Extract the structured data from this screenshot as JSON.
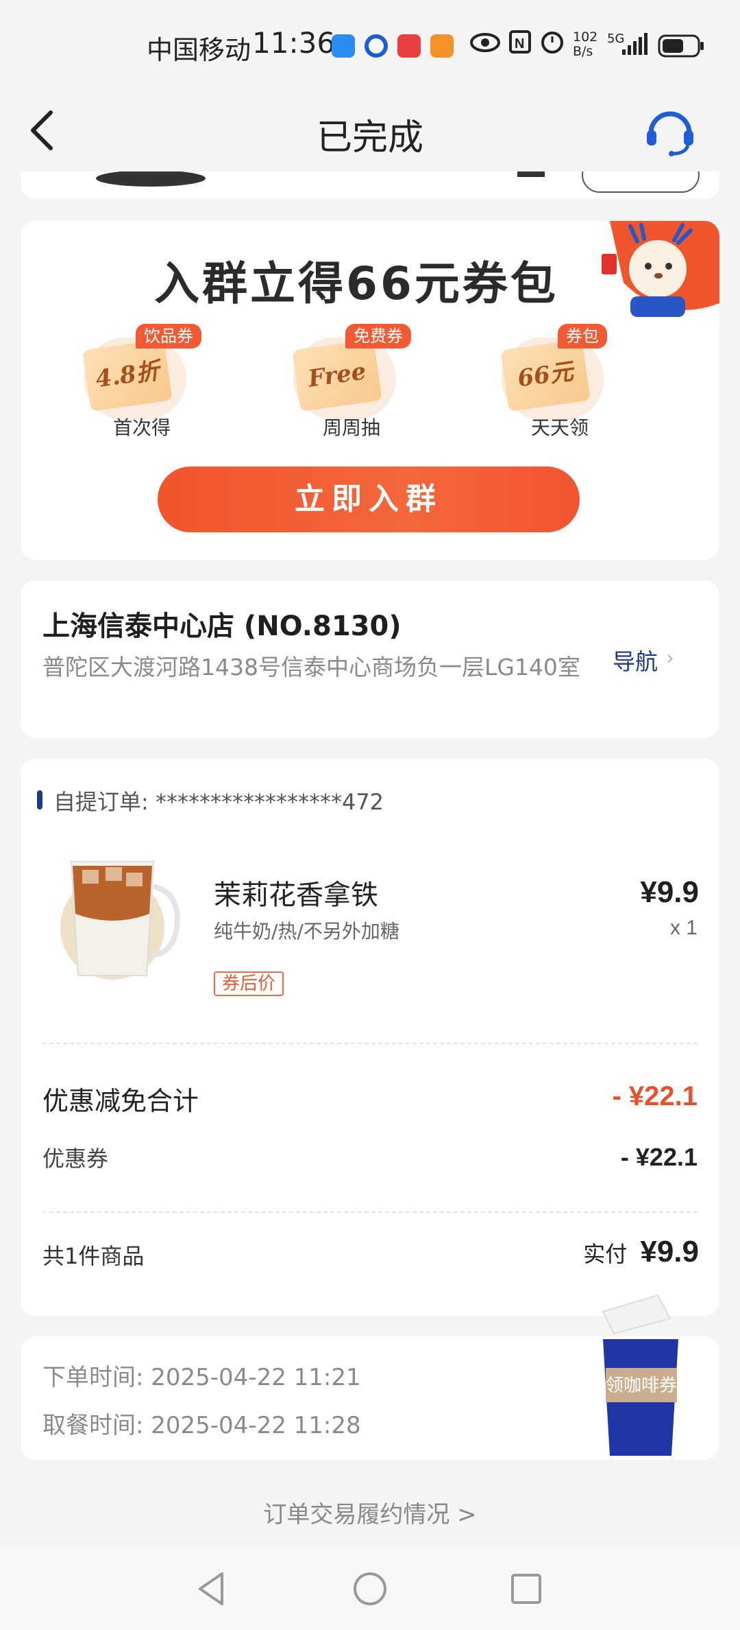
{
  "status_bar": {
    "carrier": "中国移动",
    "time": "11:36",
    "net_speed_top": "102",
    "net_speed_bottom": "B/s",
    "network": "5G"
  },
  "header": {
    "title": "已完成"
  },
  "promo": {
    "title": "入群立得66元券包",
    "benefits": [
      {
        "tag": "饮品券",
        "ticket": "4.8折",
        "label": "首次得"
      },
      {
        "tag": "免费券",
        "ticket": "Free",
        "label": "周周抽"
      },
      {
        "tag": "券包",
        "ticket": "66元",
        "label": "天天领"
      }
    ],
    "button": "立即入群"
  },
  "store": {
    "name": "上海信泰中心店 (NO.8130)",
    "address": "普陀区大渡河路1438号信泰中心商场负一层LG140室",
    "nav_label": "导航"
  },
  "order": {
    "id_label": "自提订单: *****************472",
    "item": {
      "name": "茉莉花香拿铁",
      "spec": "纯牛奶/热/不另外加糖",
      "tag": "券后价",
      "price": "¥9.9",
      "qty": "x 1"
    },
    "discount_total_label": "优惠减免合计",
    "discount_total_value": "- ¥22.1",
    "coupon_label": "优惠券",
    "coupon_value": "- ¥22.1",
    "count_label": "共1件商品",
    "paid_label": "实付",
    "paid_value": "¥9.9"
  },
  "times": {
    "order_time": "下单时间:  2025-04-22 11:21",
    "pickup_time": "取餐时间:  2025-04-22 11:28"
  },
  "coffee_cup_label": "领咖啡券",
  "footer_link": "订单交易履约情况 >",
  "colors": {
    "accent_orange": "#f25a33",
    "brand_blue": "#1d3a8a",
    "discount_red": "#e8502c"
  }
}
